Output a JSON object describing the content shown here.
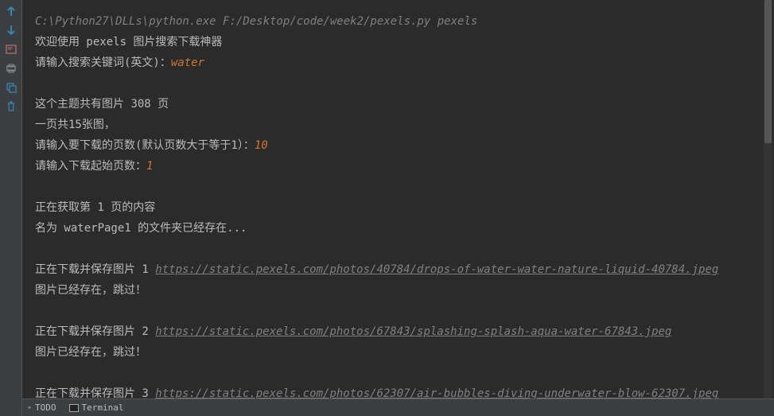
{
  "sidebar": {
    "icons": [
      {
        "name": "arrow-up-icon",
        "color": "#3592c4"
      },
      {
        "name": "arrow-down-icon",
        "color": "#3592c4"
      },
      {
        "name": "wrap-icon",
        "color": "#aa8080"
      },
      {
        "name": "print-icon",
        "color": "#808080"
      },
      {
        "name": "copy-icon",
        "color": "#3592c4"
      },
      {
        "name": "trash-icon",
        "color": "#3592c4"
      }
    ]
  },
  "terminal": {
    "command": "C:\\Python27\\DLLs\\python.exe F:/Desktop/code/week2/pexels.py pexels",
    "welcome": "欢迎使用 pexels 图片搜索下载神器",
    "prompt_keyword": "请输入搜索关键词(英文)：",
    "input_keyword": "water",
    "total_pages_prefix": "这个主题共有图片 ",
    "total_pages_count": "308",
    "total_pages_suffix": " 页",
    "per_page": "一页共15张图，",
    "prompt_pages": "请输入要下载的页数(默认页数大于等于1）：",
    "input_pages": "10",
    "prompt_start": "请输入下载起始页数：",
    "input_start": "1",
    "fetching": "正在获取第 1 页的内容",
    "folder_exists": "名为 waterPage1 的文件夹已经存在...",
    "downloads": [
      {
        "prefix": "正在下载并保存图片 1 ",
        "url": "https://static.pexels.com/photos/40784/drops-of-water-water-nature-liquid-40784.jpeg",
        "skip": "图片已经存在，跳过！"
      },
      {
        "prefix": "正在下载并保存图片 2 ",
        "url": "https://static.pexels.com/photos/67843/splashing-splash-aqua-water-67843.jpeg",
        "skip": "图片已经存在，跳过！"
      },
      {
        "prefix": "正在下载并保存图片 3 ",
        "url": "https://static.pexels.com/photos/62307/air-bubbles-diving-underwater-blow-62307.jpeg",
        "skip": ""
      }
    ]
  },
  "bottom": {
    "todo_label": "TODO",
    "terminal_label": "Terminal"
  }
}
